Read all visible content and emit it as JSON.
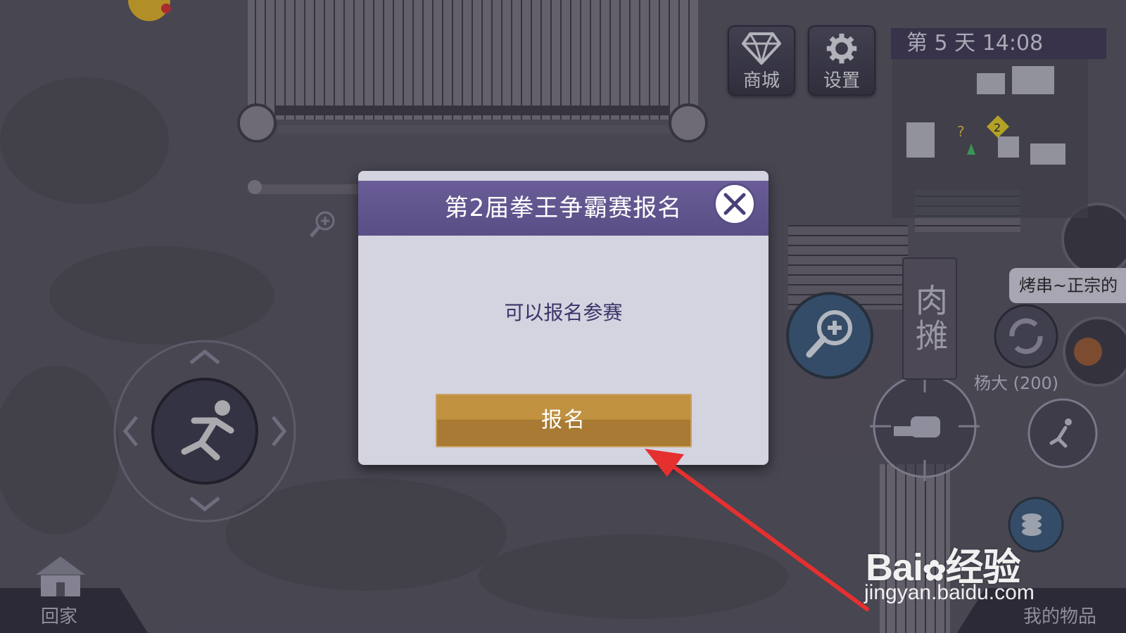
{
  "hud": {
    "shop_label": "商城",
    "settings_label": "设置",
    "clock": "第 5 天 14:08"
  },
  "world": {
    "stall_sign": "肉摊",
    "npc_bubble": "烤串~正宗的",
    "npc_name": "杨大 (200)",
    "minimap_marker_number": "2",
    "minimap_unknown_marker": "?"
  },
  "dialog": {
    "title": "第2届拳王争霸赛报名",
    "message": "可以报名参赛",
    "signup_label": "报名"
  },
  "bottom": {
    "home_label": "回家",
    "inventory_label": "我的物品"
  },
  "watermark": {
    "brand": "Bai",
    "brand_suffix": "经验",
    "url": "jingyan.baidu.com"
  },
  "colors": {
    "dialog_header": "#5a4e86",
    "signup_button": "#b88a3c",
    "annotation_arrow": "#e53030"
  }
}
